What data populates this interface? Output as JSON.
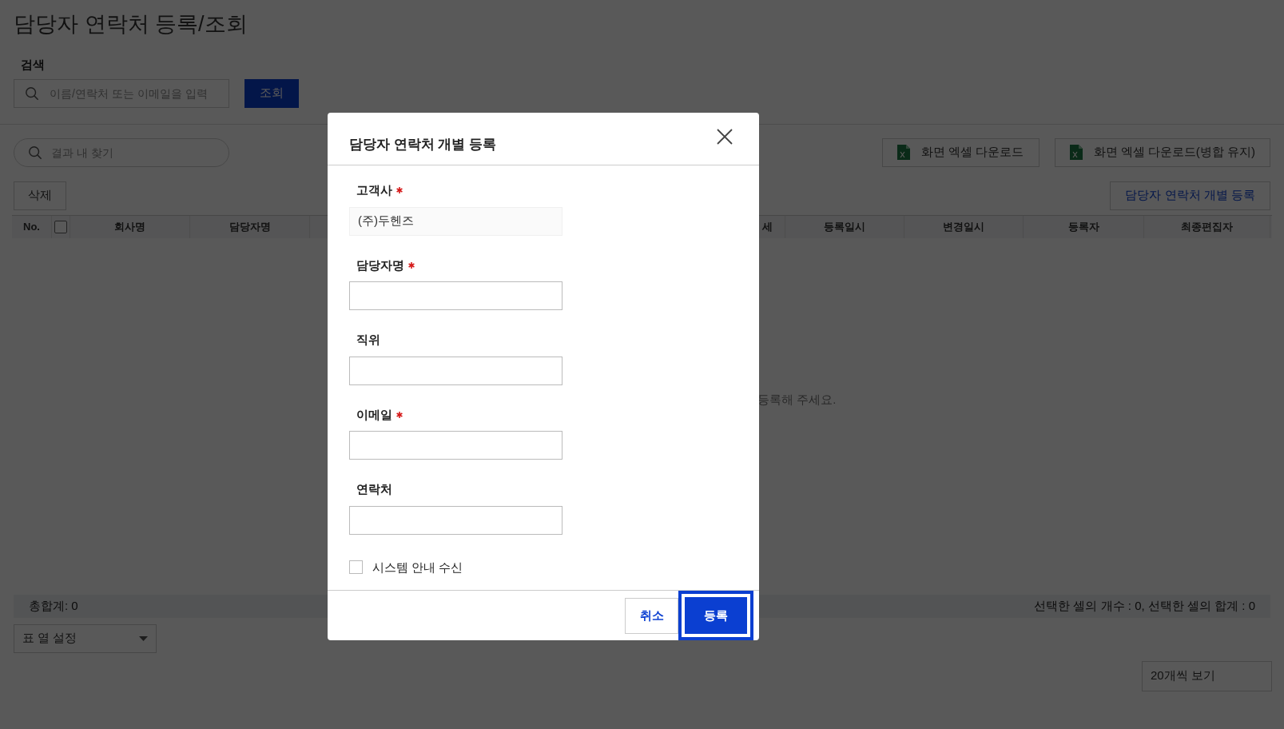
{
  "page": {
    "title": "담당자 연락처 등록/조회",
    "search": {
      "label": "검색",
      "placeholder": "이름/연락처 또는 이메일을 입력",
      "button": "조회"
    },
    "filter": {
      "placeholder": "결과 내 찾기"
    },
    "excel_buttons": [
      "화면 엑셀 다운로드",
      "화면 엑셀 다운로드(병합 유지)"
    ],
    "delete_button": "삭제",
    "register_button": "담당자 연락처 개별 등록",
    "table": {
      "columns": [
        {
          "kind": "text",
          "label": "No."
        },
        {
          "kind": "checkbox",
          "checked": false
        },
        {
          "kind": "text",
          "label": "회사명"
        },
        {
          "kind": "text",
          "label": "담당자명"
        },
        {
          "kind": "text",
          "label": "세"
        },
        {
          "kind": "text",
          "label": "등록일시"
        },
        {
          "kind": "text",
          "label": "변경일시"
        },
        {
          "kind": "text",
          "label": "등록자"
        },
        {
          "kind": "text",
          "label": "최종편집자"
        }
      ],
      "empty_message": "등록해 주세요."
    },
    "summary": {
      "total": "총합계: 0",
      "selection": "선택한 셀의 개수 : 0, 선택한 셀의 합계 : 0"
    },
    "column_settings": "표 열 설정",
    "page_size": "20개씩 보기"
  },
  "dialog": {
    "title": "담당자 연락처 개별 등록",
    "fields": [
      {
        "label": "고객사",
        "required": true,
        "readonly": true,
        "value": "(주)두헨즈"
      },
      {
        "label": "담당자명",
        "required": true,
        "readonly": false
      },
      {
        "label": "직위",
        "required": false,
        "readonly": false
      },
      {
        "label": "이메일",
        "required": true,
        "readonly": false
      },
      {
        "label": "연락처",
        "required": false,
        "readonly": false
      }
    ],
    "checkbox": {
      "label": "시스템 안내 수신",
      "checked": false
    },
    "buttons": [
      {
        "label": "취소",
        "kind": "secondary",
        "focused": false
      },
      {
        "label": "등록",
        "kind": "primary",
        "focused": true
      }
    ]
  }
}
